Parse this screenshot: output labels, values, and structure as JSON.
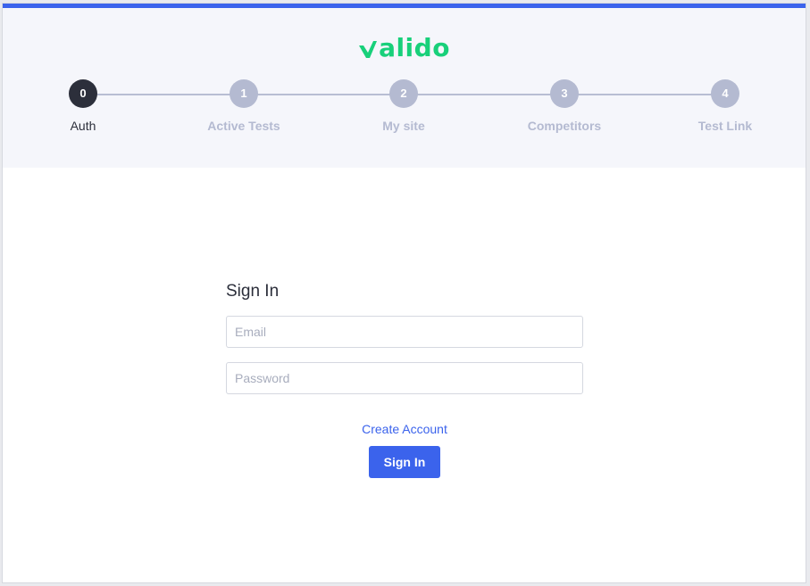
{
  "brand": {
    "name": "alido",
    "logo_icon": "check-v-icon",
    "accent_color": "#18d07a"
  },
  "colors": {
    "primary": "#3b63ec",
    "step_active": "#2c2f3b",
    "step_inactive": "#b4bad1"
  },
  "stepper": {
    "steps": [
      {
        "number": "0",
        "label": "Auth"
      },
      {
        "number": "1",
        "label": "Active Tests"
      },
      {
        "number": "2",
        "label": "My site"
      },
      {
        "number": "3",
        "label": "Competitors"
      },
      {
        "number": "4",
        "label": "Test Link"
      }
    ]
  },
  "signin": {
    "title": "Sign In",
    "email_placeholder": "Email",
    "password_placeholder": "Password",
    "create_account_label": "Create Account",
    "submit_label": "Sign In"
  }
}
